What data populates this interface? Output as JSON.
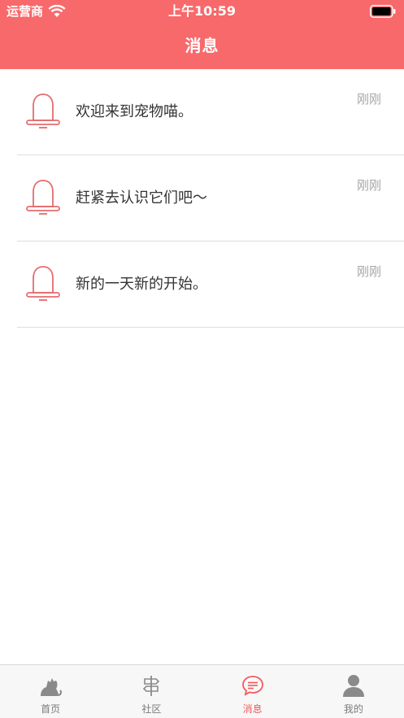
{
  "status": {
    "carrier": "运营商",
    "time": "上午10:59"
  },
  "header": {
    "title": "消息"
  },
  "messages": [
    {
      "text": "欢迎来到宠物喵。",
      "time": "刚刚"
    },
    {
      "text": "赶紧去认识它们吧～",
      "time": "刚刚"
    },
    {
      "text": "新的一天新的开始。",
      "time": "刚刚"
    }
  ],
  "tabs": [
    {
      "label": "首页",
      "icon": "cat-icon"
    },
    {
      "label": "社区",
      "icon": "signpost-icon"
    },
    {
      "label": "消息",
      "icon": "chat-icon",
      "active": true
    },
    {
      "label": "我的",
      "icon": "user-icon"
    }
  ],
  "colors": {
    "brand": "#f8696b",
    "active_tab": "#f3595b",
    "bell": "#e46c6e"
  }
}
